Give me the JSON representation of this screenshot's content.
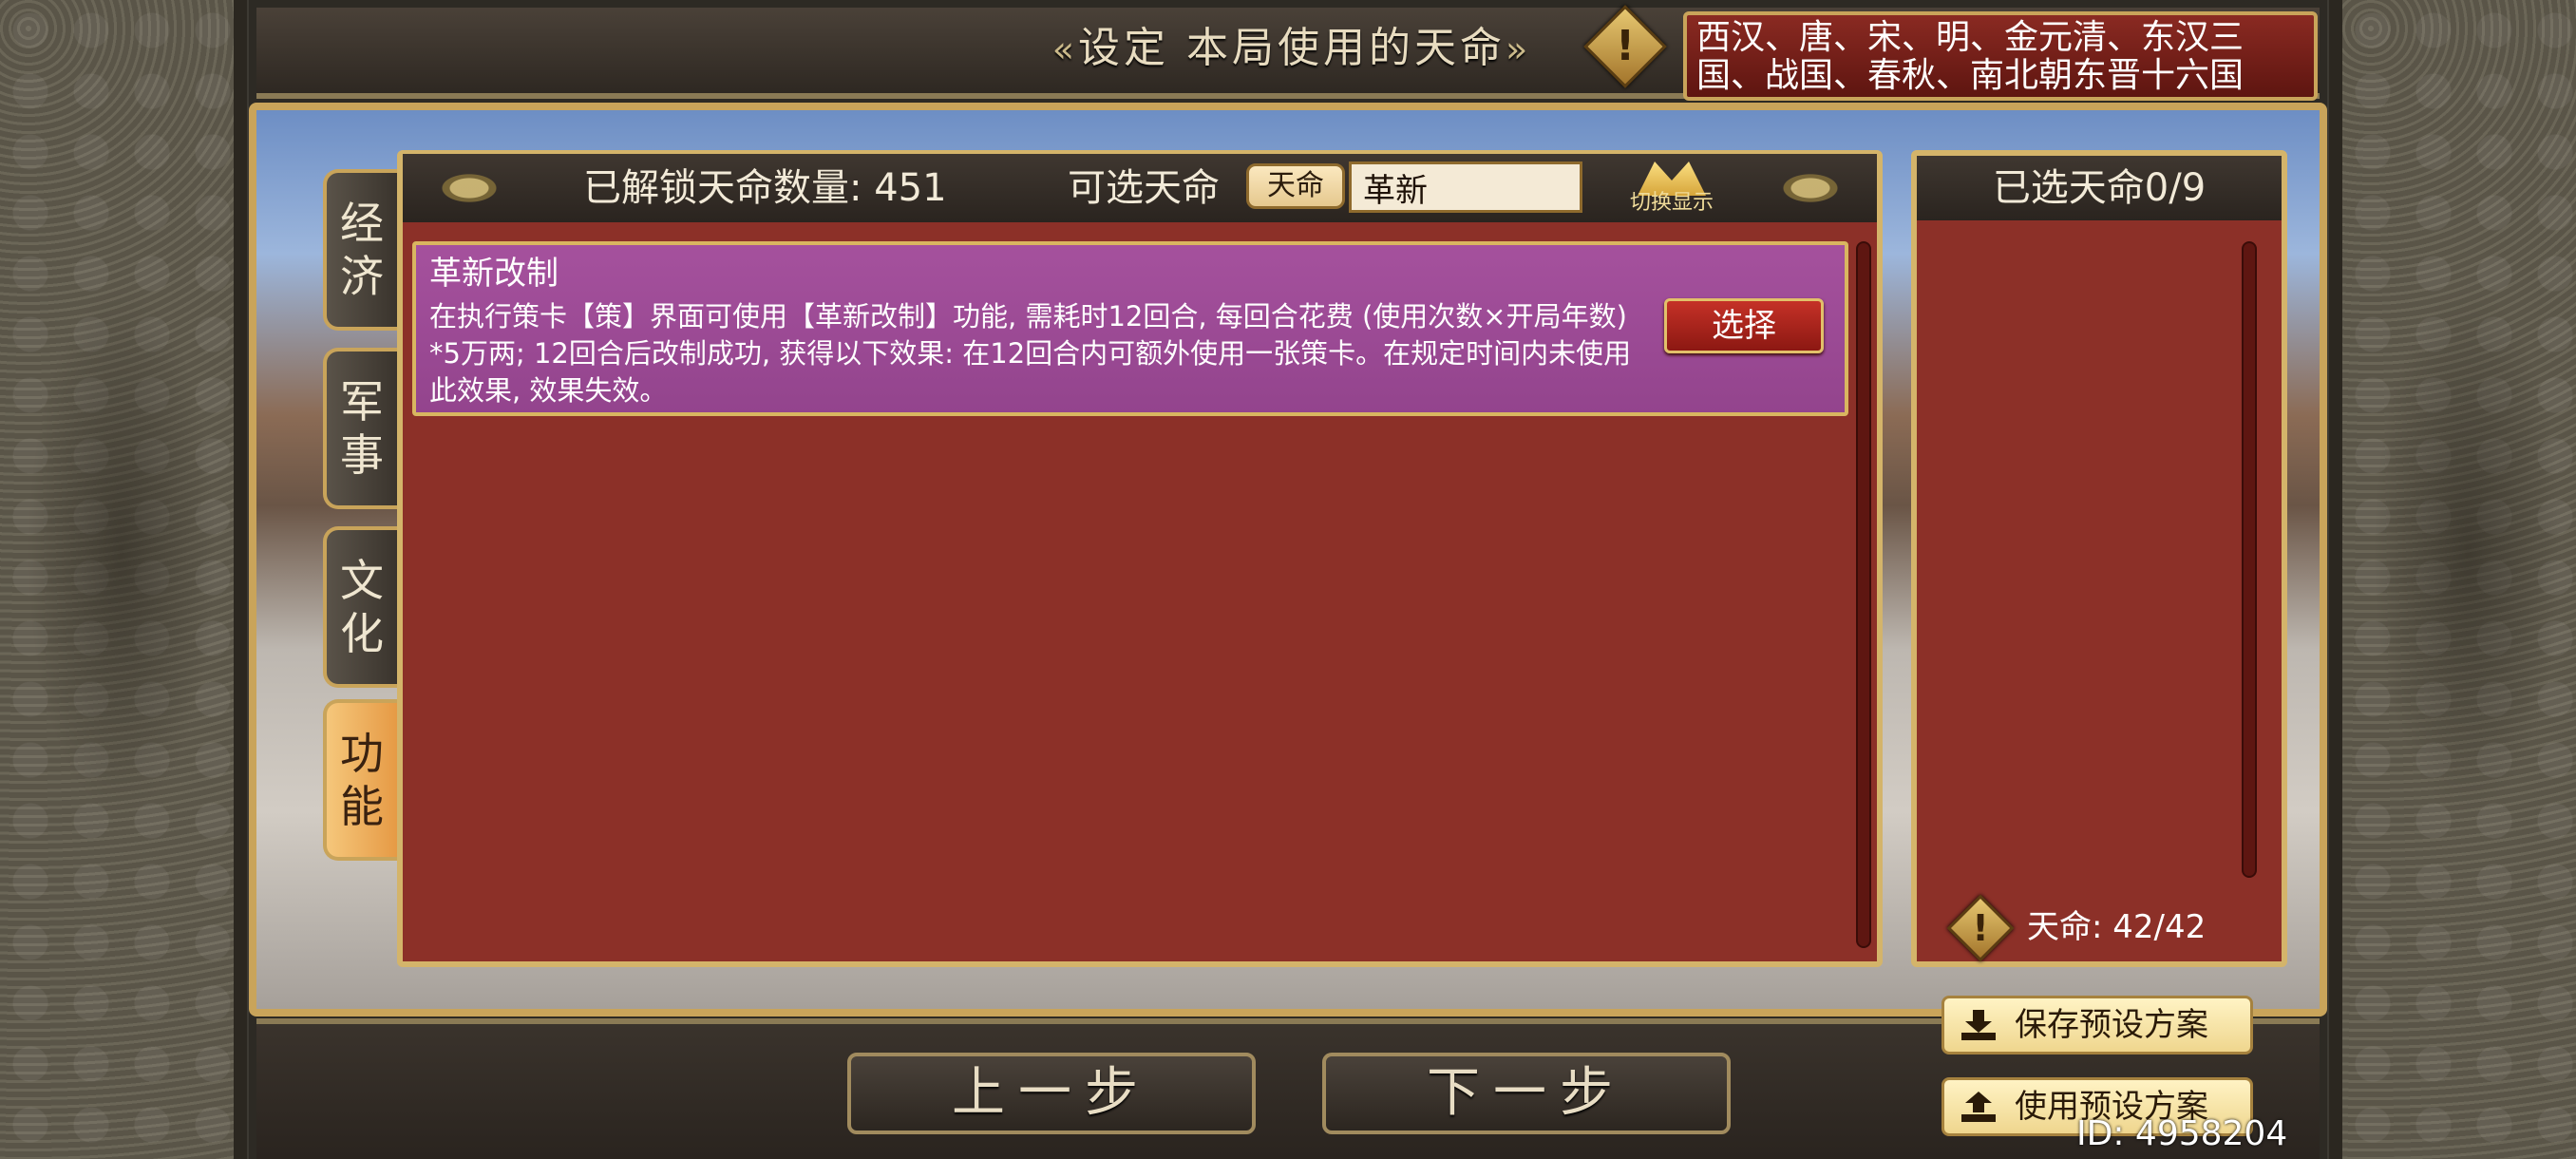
{
  "header": {
    "title": "设定 本局使用的天命",
    "title_ornament_left": "«",
    "title_ornament_right": "»",
    "warning_mark": "!",
    "dynasties": "西汉、唐、宋、明、金元清、东汉三国、战国、春秋、南北朝东晋十六国"
  },
  "tabs": [
    {
      "label": "经济",
      "active": false
    },
    {
      "label": "军事",
      "active": false
    },
    {
      "label": "文化",
      "active": false
    },
    {
      "label": "功能",
      "active": true
    }
  ],
  "main_panel": {
    "unlocked_label": "已解锁天命数量: 451",
    "selectable_label": "可选天命",
    "filter_chip": "天命",
    "search_value": "革新",
    "switch_label": "切换显示",
    "item": {
      "title": "革新改制",
      "description": "在执行策卡【策】界面可使用【革新改制】功能, 需耗时12回合, 每回合花费 (使用次数×开局年数) *5万两; 12回合后改制成功, 获得以下效果: 在12回合内可额外使用一张策卡。在规定时间内未使用此效果, 效果失效。",
      "button": "选择"
    }
  },
  "right_panel": {
    "title": "已选天命0/9",
    "count": "天命: 42/42"
  },
  "presets": {
    "save": "保存预设方案",
    "use": "使用预设方案"
  },
  "nav": {
    "prev": "上一步",
    "next": "下一步"
  },
  "footer": {
    "id": "ID: 4958204"
  },
  "colors": {
    "panel_red": "#8c3028",
    "gold_border": "#d4b46a",
    "card_purple": "#a5519d",
    "active_tab": "#f5c77b"
  }
}
